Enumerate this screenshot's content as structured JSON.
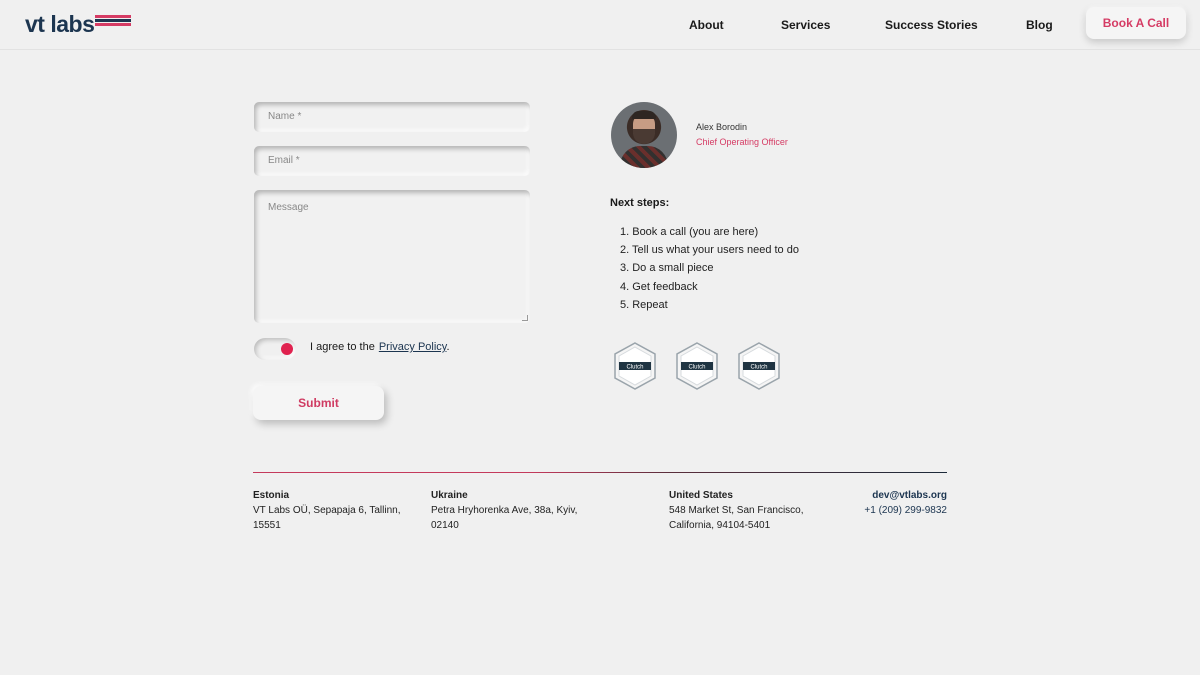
{
  "header": {
    "logo_text": "vt labs",
    "brand_colors": {
      "navy": "#1c3550",
      "red": "#d53b64"
    },
    "nav": [
      "About",
      "Services",
      "Success Stories",
      "Blog"
    ],
    "cta": "Book A Call"
  },
  "form": {
    "name_placeholder": "Name *",
    "email_placeholder": "Email *",
    "message_placeholder": "Message",
    "consent_on": true,
    "agree_text": "I agree to the",
    "privacy_link": "Privacy Policy",
    "agree_suffix": ".",
    "submit_label": "Submit"
  },
  "contact_person": {
    "name": "Alex Borodin",
    "role": "Chief Operating Officer"
  },
  "next_steps": {
    "title": "Next steps:",
    "items": [
      "1. Book a call (you are here)",
      "2. Tell us what your users need to do",
      "3. Do a small piece",
      "4. Get feedback",
      "5. Repeat"
    ]
  },
  "badges": [
    "Clutch",
    "Clutch",
    "Clutch"
  ],
  "footer": {
    "offices": [
      {
        "country": "Estonia",
        "line1": "VT Labs OÜ, Sepapaja 6, Tallinn,",
        "line2": "15551"
      },
      {
        "country": "Ukraine",
        "line1": "Petra Hryhorenka Ave, 38a, Kyiv,",
        "line2": "02140"
      },
      {
        "country": "United States",
        "line1": "548 Market St, San Francisco,",
        "line2": "California, 94104-5401"
      }
    ],
    "email": "dev@vtlabs.org",
    "phone": "+1 (209) 299-9832"
  }
}
